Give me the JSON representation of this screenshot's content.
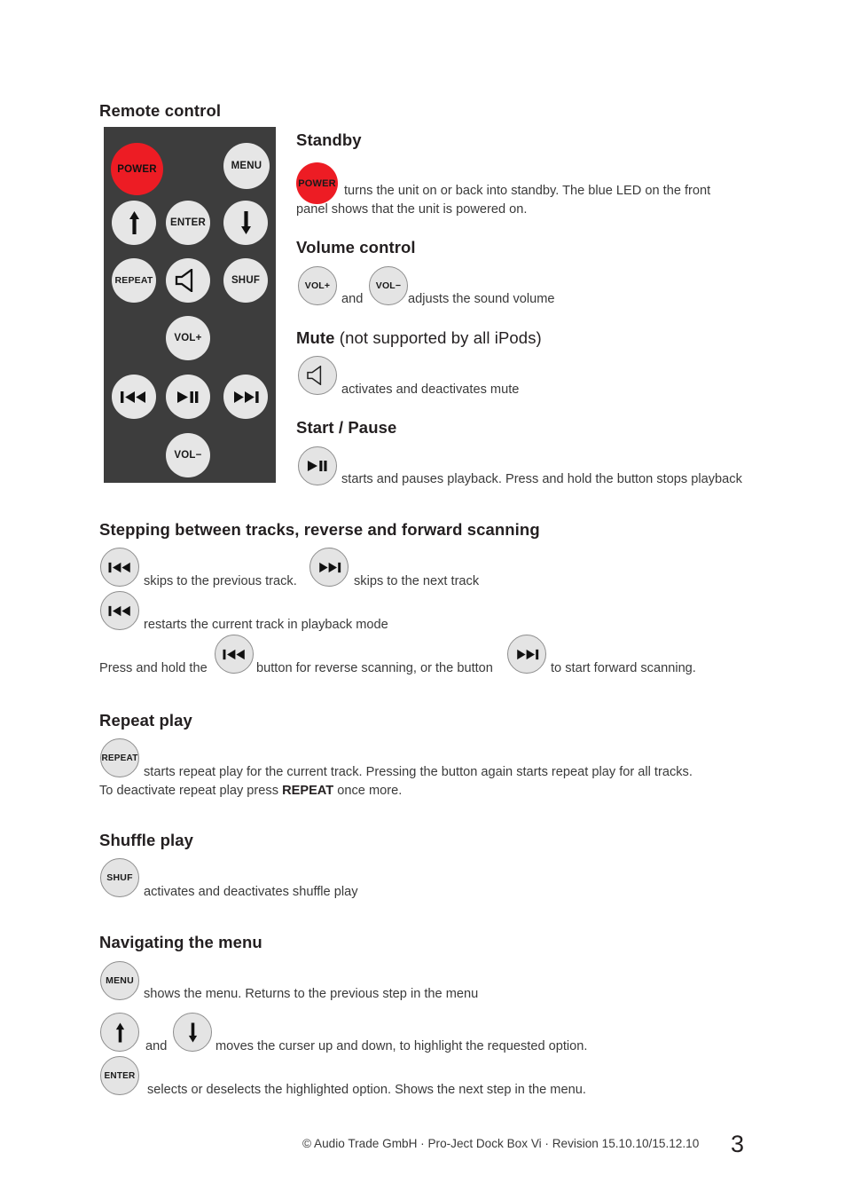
{
  "document": {
    "title": "Remote control",
    "page_number": "3",
    "footer": "© Audio Trade GmbH · Pro-Ject Dock Box Vi · Revision 15.10.10/15.12.10"
  },
  "remote": {
    "buttons": [
      {
        "name": "power",
        "label": "POWER"
      },
      {
        "name": "menu",
        "label": "MENU"
      },
      {
        "name": "up",
        "label": ""
      },
      {
        "name": "enter",
        "label": "ENTER"
      },
      {
        "name": "down",
        "label": ""
      },
      {
        "name": "repeat",
        "label": "REPEAT"
      },
      {
        "name": "mute",
        "label": ""
      },
      {
        "name": "shuffle",
        "label": "SHUF"
      },
      {
        "name": "volume-up",
        "label": "VOL+"
      },
      {
        "name": "previous",
        "label": ""
      },
      {
        "name": "play-pause",
        "label": ""
      },
      {
        "name": "next",
        "label": ""
      },
      {
        "name": "volume-down",
        "label": "VOL−"
      }
    ]
  },
  "sections": {
    "standby": {
      "heading": "Standby",
      "button_label": "POWER",
      "text_line1": "turns the unit on or back into standby. The blue LED on the front",
      "text_line2": "panel shows that the unit is powered on."
    },
    "volume": {
      "heading": "Volume control",
      "button_up_label": "VOL+",
      "button_down_label": "VOL−",
      "text_and": "and",
      "text_after": "adjusts the sound volume"
    },
    "mute": {
      "heading_bold": "Mute",
      "heading_light": " (not supported by all iPods)",
      "text": "activates and deactivates mute"
    },
    "start_pause": {
      "heading": "Start / Pause",
      "text": "starts and pauses playback. Press and hold the button stops playback"
    },
    "stepping": {
      "heading": "Stepping between tracks, reverse and forward scanning",
      "text_prev": "skips to the previous track.",
      "text_next": "skips to the next track",
      "text_restart": "restarts the current track in playback mode",
      "text_hold_pre": "Press and hold the",
      "text_hold_mid": "button for reverse scanning, or the button",
      "text_hold_post": "to start forward scanning."
    },
    "repeat": {
      "heading": "Repeat play",
      "button_label": "REPEAT",
      "text_line1": "starts repeat play for the current track. Pressing the button again starts repeat play for all tracks.",
      "text_line2_pre": "To deactivate repeat play press ",
      "text_line2_bold": "REPEAT",
      "text_line2_post": " once more."
    },
    "shuffle": {
      "heading": "Shuffle play",
      "button_label": "SHUF",
      "text": "activates and deactivates shuffle play"
    },
    "navigating": {
      "heading": "Navigating the menu",
      "menu_label": "MENU",
      "menu_text": "shows the menu. Returns to the previous step in the menu",
      "arrows_and": "and",
      "arrows_text": "moves the curser up and down, to highlight the requested option.",
      "enter_label": "ENTER",
      "enter_text": "selects or deselects the highlighted option. Shows the next step in the menu."
    }
  },
  "colors": {
    "remote_body": "#3d3d3d",
    "power_red": "#ed1c24",
    "button_grey": "#e6e6e6",
    "text": "#231f20"
  }
}
